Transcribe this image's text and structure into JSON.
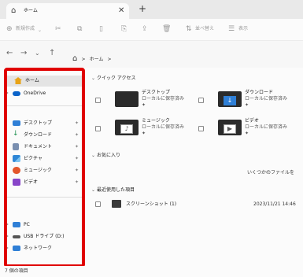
{
  "window": {
    "title": "ホーム"
  },
  "tabs": {
    "home_icon": "⌂",
    "close_icon": "✕",
    "new_icon": "+"
  },
  "toolbar": {
    "new_label": "新規作成",
    "sort_label": "並べ替え",
    "view_label": "表示"
  },
  "nav": {
    "back": "←",
    "forward": "→",
    "recent": "⌄",
    "up": "↑",
    "path_root": "⌂",
    "path_sep": ">",
    "path_item": "ホーム"
  },
  "sidebar": {
    "items": [
      {
        "label": "ホーム",
        "icon": "home-icon",
        "color": "#e8a317"
      },
      {
        "label": "OneDrive",
        "icon": "cloud-icon",
        "color": "#0a63c9"
      },
      {
        "label": "デスクトップ",
        "icon": "desktop-icon",
        "color": "#2f7fd6"
      },
      {
        "label": "ダウンロード",
        "icon": "download-icon",
        "color": "#1d8f4e"
      },
      {
        "label": "ドキュメント",
        "icon": "document-icon",
        "color": "#7a8fb0"
      },
      {
        "label": "ピクチャ",
        "icon": "pictures-icon",
        "color": "#2f87d6"
      },
      {
        "label": "ミュージック",
        "icon": "music-icon",
        "color": "#e3572c"
      },
      {
        "label": "ビデオ",
        "icon": "video-icon",
        "color": "#8845c9"
      },
      {
        "label": "PC",
        "icon": "pc-icon",
        "color": "#2f7fd6"
      },
      {
        "label": "USB ドライブ (D:)",
        "icon": "usb-drive-icon",
        "color": "#555555"
      },
      {
        "label": "ネットワーク",
        "icon": "network-icon",
        "color": "#2f7fd6"
      }
    ],
    "pin": "📌"
  },
  "content": {
    "quick_access": "クイック アクセス",
    "folders": [
      {
        "name": "デスクトップ",
        "sub": "ローカルに保存済み"
      },
      {
        "name": "ダウンロード",
        "sub": "ローカルに保存済み"
      },
      {
        "name": "ミュージック",
        "sub": "ローカルに保存済み"
      },
      {
        "name": "ビデオ",
        "sub": "ローカルに保存済み"
      }
    ],
    "favorites": "お気に入り",
    "favorites_empty": "いくつかのファイルを",
    "recent": "最近使用した項目",
    "recent_file": {
      "name": "スクリーンショット (1)",
      "date": "2023/11/21 14:46"
    }
  },
  "status": {
    "count": "7 個の項目"
  },
  "colors": {
    "highlight": "#e00000"
  }
}
